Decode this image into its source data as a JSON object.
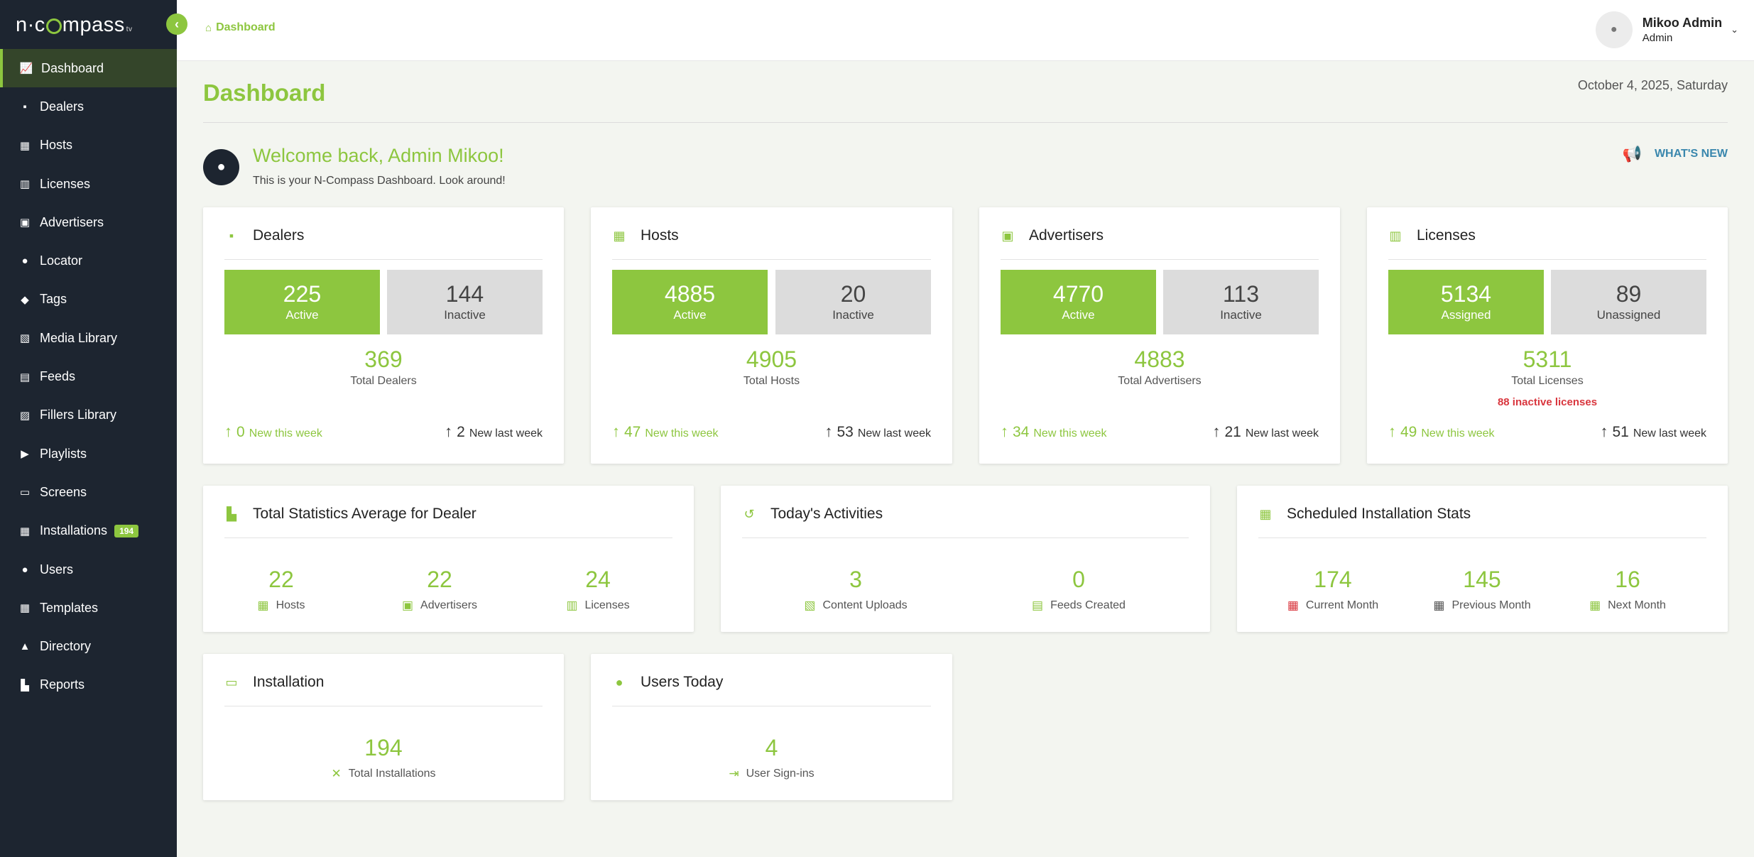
{
  "app": {
    "logo_text_left": "n·c",
    "logo_text_right": "mpass",
    "logo_suffix": "tv"
  },
  "sidebar": {
    "items": [
      {
        "label": "Dashboard",
        "icon": "chart-line-icon",
        "glyph": "📈",
        "active": true
      },
      {
        "label": "Dealers",
        "icon": "briefcase-icon",
        "glyph": "▪"
      },
      {
        "label": "Hosts",
        "icon": "map-icon",
        "glyph": "▦"
      },
      {
        "label": "Licenses",
        "icon": "barcode-icon",
        "glyph": "▥"
      },
      {
        "label": "Advertisers",
        "icon": "ad-icon",
        "glyph": "▣"
      },
      {
        "label": "Locator",
        "icon": "map-marker-icon",
        "glyph": "●"
      },
      {
        "label": "Tags",
        "icon": "tags-icon",
        "glyph": "◆"
      },
      {
        "label": "Media Library",
        "icon": "images-icon",
        "glyph": "▧"
      },
      {
        "label": "Feeds",
        "icon": "feed-icon",
        "glyph": "▤"
      },
      {
        "label": "Fillers Library",
        "icon": "fillers-icon",
        "glyph": "▨"
      },
      {
        "label": "Playlists",
        "icon": "play-icon",
        "glyph": "▶"
      },
      {
        "label": "Screens",
        "icon": "desktop-icon",
        "glyph": "▭"
      },
      {
        "label": "Installations",
        "icon": "calendar-icon",
        "glyph": "▦",
        "badge": "194"
      },
      {
        "label": "Users",
        "icon": "users-icon",
        "glyph": "●"
      },
      {
        "label": "Templates",
        "icon": "th-large-icon",
        "glyph": "▦"
      },
      {
        "label": "Directory",
        "icon": "sitemap-icon",
        "glyph": "▲"
      },
      {
        "label": "Reports",
        "icon": "chart-bar-icon",
        "glyph": "▙"
      }
    ]
  },
  "topbar": {
    "breadcrumb": "Dashboard",
    "user_name": "Mikoo Admin",
    "user_role": "Admin"
  },
  "main": {
    "title": "Dashboard",
    "date": "October 4, 2025, Saturday",
    "welcome_title": "Welcome back, Admin Mikoo!",
    "welcome_sub": "This is your N-Compass Dashboard. Look around!",
    "whats_new": "WHAT'S NEW"
  },
  "cards": {
    "dealers": {
      "title": "Dealers",
      "a_num": "225",
      "a_lbl": "Active",
      "b_num": "144",
      "b_lbl": "Inactive",
      "total": "369",
      "total_lbl": "Total Dealers",
      "new_this": "0",
      "new_this_lbl": "New this week",
      "new_last": "2",
      "new_last_lbl": "New last week"
    },
    "hosts": {
      "title": "Hosts",
      "a_num": "4885",
      "a_lbl": "Active",
      "b_num": "20",
      "b_lbl": "Inactive",
      "total": "4905",
      "total_lbl": "Total Hosts",
      "new_this": "47",
      "new_this_lbl": "New this week",
      "new_last": "53",
      "new_last_lbl": "New last week"
    },
    "advertisers": {
      "title": "Advertisers",
      "a_num": "4770",
      "a_lbl": "Active",
      "b_num": "113",
      "b_lbl": "Inactive",
      "total": "4883",
      "total_lbl": "Total Advertisers",
      "new_this": "34",
      "new_this_lbl": "New this week",
      "new_last": "21",
      "new_last_lbl": "New last week"
    },
    "licenses": {
      "title": "Licenses",
      "a_num": "5134",
      "a_lbl": "Assigned",
      "b_num": "89",
      "b_lbl": "Unassigned",
      "total": "5311",
      "total_lbl": "Total Licenses",
      "warning": "88 inactive licenses",
      "new_this": "49",
      "new_this_lbl": "New this week",
      "new_last": "51",
      "new_last_lbl": "New last week"
    }
  },
  "stats_avg": {
    "title": "Total Statistics Average for Dealer",
    "hosts": "22",
    "hosts_lbl": "Hosts",
    "advertisers": "22",
    "advertisers_lbl": "Advertisers",
    "licenses": "24",
    "licenses_lbl": "Licenses"
  },
  "activities": {
    "title": "Today's Activities",
    "uploads": "3",
    "uploads_lbl": "Content Uploads",
    "feeds": "0",
    "feeds_lbl": "Feeds Created"
  },
  "scheduled": {
    "title": "Scheduled Installation Stats",
    "current": "174",
    "current_lbl": "Current Month",
    "previous": "145",
    "previous_lbl": "Previous Month",
    "next": "16",
    "next_lbl": "Next Month"
  },
  "installation": {
    "title": "Installation",
    "total": "194",
    "total_lbl": "Total Installations"
  },
  "users_today": {
    "title": "Users Today",
    "total": "4",
    "total_lbl": "User Sign-ins"
  },
  "colors": {
    "accent": "#8dc63f",
    "sidebar": "#1d2530",
    "warning": "#d9363e",
    "link": "#3a87ad"
  }
}
